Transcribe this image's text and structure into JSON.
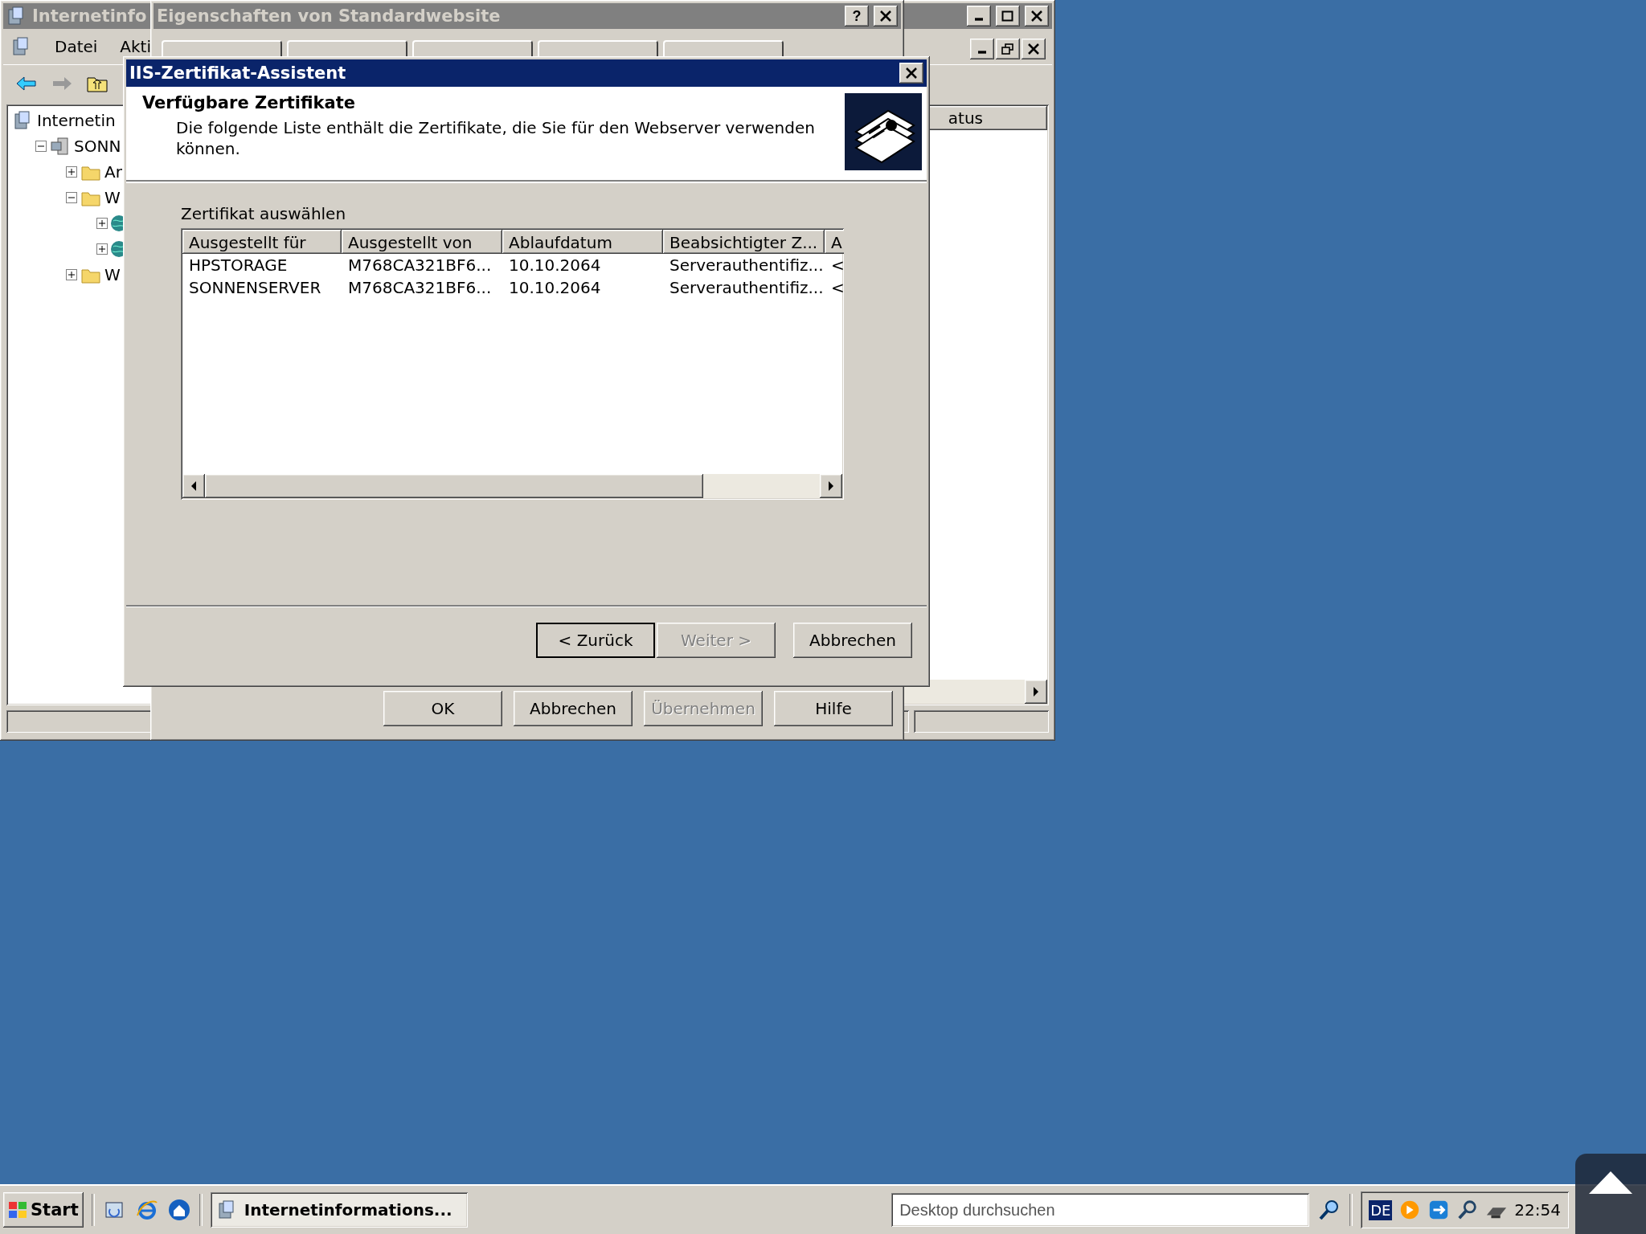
{
  "mmc_window": {
    "title": "Internetinfo",
    "menu": [
      "Datei",
      "Akti"
    ],
    "tree": [
      {
        "kind": "root",
        "label": "Internetin",
        "children": [
          {
            "kind": "server",
            "label": "SONN",
            "expanded": true,
            "children": [
              {
                "kind": "folder",
                "label": "Ar",
                "expanded": false
              },
              {
                "kind": "folder",
                "label": "W",
                "expanded": true,
                "children": [
                  {
                    "kind": "site",
                    "expanded": false
                  },
                  {
                    "kind": "site",
                    "expanded": false
                  }
                ]
              },
              {
                "kind": "folder",
                "label": "W",
                "expanded": false
              }
            ]
          }
        ]
      }
    ],
    "list_header": "atus"
  },
  "properties_dialog": {
    "title": "Eigenschaften von Standardwebsite",
    "help_glyph": "?",
    "buttons": [
      {
        "label": "OK",
        "disabled": false
      },
      {
        "label": "Abbrechen",
        "disabled": false
      },
      {
        "label": "Übernehmen",
        "disabled": true
      },
      {
        "label": "Hilfe",
        "disabled": false
      }
    ]
  },
  "wizard": {
    "title": "IIS-Zertifikat-Assistent",
    "heading": "Verfügbare Zertifikate",
    "description": "Die folgende Liste enthält die Zertifikate, die Sie für den Webserver verwenden können.",
    "list_label": "Zertifikat auswählen",
    "table": {
      "columns": [
        "Ausgestellt für",
        "Ausgestellt von",
        "Ablaufdatum",
        "Beabsichtigter Z...",
        "A"
      ],
      "rows": [
        [
          "HPSTORAGE",
          "M768CA321BF6...",
          "10.10.2064",
          "Serverauthentifiz...",
          "<"
        ],
        [
          "SONNENSERVER",
          "M768CA321BF6...",
          "10.10.2064",
          "Serverauthentifiz...",
          "<"
        ]
      ]
    },
    "buttons": [
      {
        "label": "< Zurück",
        "disabled": false,
        "default": true
      },
      {
        "label": "Weiter >",
        "disabled": true,
        "default": false
      },
      {
        "label": "Abbrechen",
        "disabled": false,
        "default": false
      }
    ]
  },
  "taskbar": {
    "start": "Start",
    "tasks": [
      {
        "label": "Internetinformations...",
        "selected": true
      }
    ],
    "search": {
      "placeholder": "Desktop durchsuchen"
    },
    "language": "DE",
    "clock": "22:54"
  }
}
